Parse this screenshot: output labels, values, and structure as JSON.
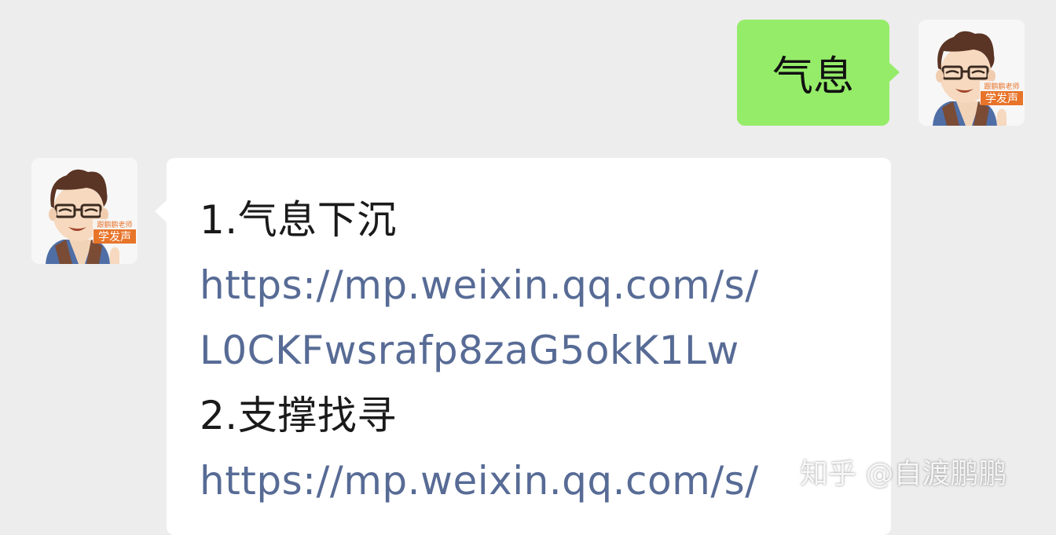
{
  "chat": {
    "sent_message": "气息",
    "received_message": {
      "lines": [
        {
          "text": "1.气息下沉",
          "kind": "text"
        },
        {
          "text": "https://mp.weixin.qq.com/s/",
          "kind": "link"
        },
        {
          "text": "L0CKFwsrafp8zaG5okK1Lw",
          "kind": "link"
        },
        {
          "text": "2.支撑找寻",
          "kind": "text"
        },
        {
          "text": "https://mp.weixin.qq.com/s/",
          "kind": "link"
        }
      ]
    },
    "avatar_badge": {
      "top": "跟鹏鹏老师",
      "bottom": "学发声"
    }
  },
  "watermark": "知乎 @自渡鹏鹏",
  "colors": {
    "background": "#ededed",
    "sent_bubble": "#95ec69",
    "received_bubble": "#ffffff",
    "link": "#576b95",
    "badge": "#e8742a"
  }
}
